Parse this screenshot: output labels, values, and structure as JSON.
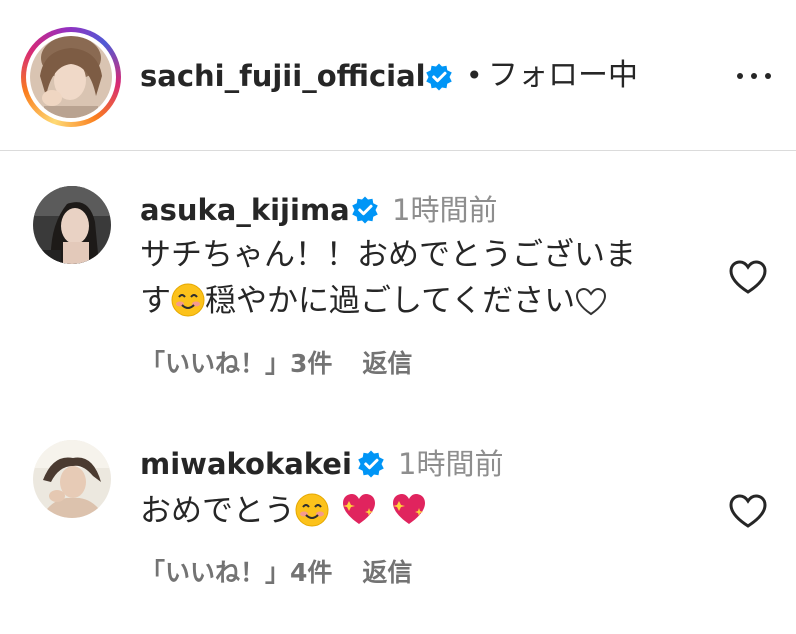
{
  "post_header": {
    "username": "sachi_fujii_official",
    "separator": "•",
    "follow_status": "フォロー中",
    "more_icon": "more-horizontal-icon"
  },
  "comments": [
    {
      "username": "asuka_kijima",
      "time": "1時間前",
      "text_line1": "サチちゃん！！おめでとうございま",
      "text_line2_a": "す",
      "text_line2_b": "穏やかに過ごしてください",
      "likes": "「いいね！」3件",
      "reply": "返信"
    },
    {
      "username": "miwakokakei",
      "time": "1時間前",
      "text": "おめでとう",
      "likes": "「いいね！」4件",
      "reply": "返信"
    }
  ],
  "colors": {
    "verified": "#0095f6",
    "secondary_text": "#8e8e8e",
    "meta_text": "#737373",
    "divider": "#dbdbdb"
  }
}
